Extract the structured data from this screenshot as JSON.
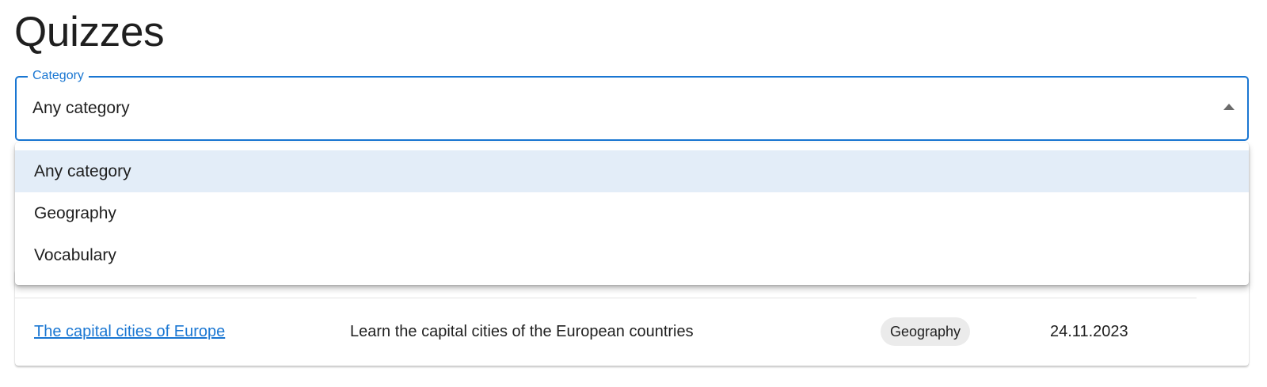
{
  "page": {
    "title": "Quizzes"
  },
  "filter": {
    "label": "Category",
    "selected": "Any category",
    "options": [
      "Any category",
      "Geography",
      "Vocabulary"
    ]
  },
  "table": {
    "rows": [
      {
        "title": "The capital cities of Europe",
        "description": "Learn the capital cities of the European countries",
        "category": "Geography",
        "date": "24.11.2023"
      }
    ]
  },
  "colors": {
    "accent": "#1976d2",
    "selected_option_bg": "#e3edf8",
    "chip_bg": "#ebebeb"
  },
  "icons": {
    "select_arrow": "caret-up-icon"
  }
}
